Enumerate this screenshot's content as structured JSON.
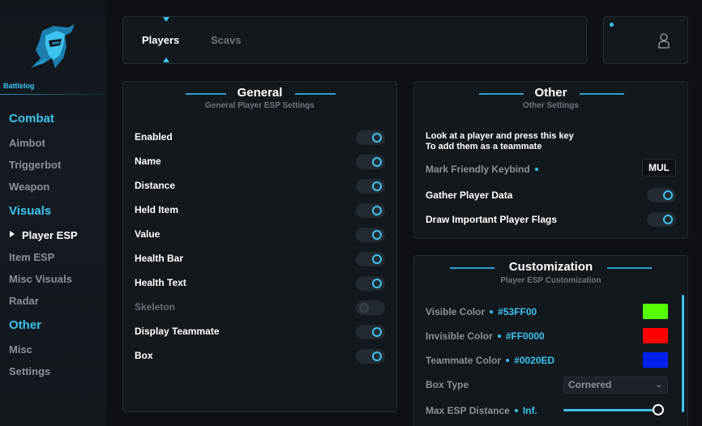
{
  "sidebar": {
    "brand": "Battlelog",
    "sections": [
      {
        "title": "Combat",
        "items": [
          "Aimbot",
          "Triggerbot",
          "Weapon"
        ]
      },
      {
        "title": "Visuals",
        "items": [
          "Player ESP",
          "Item ESP",
          "Misc Visuals",
          "Radar"
        ]
      },
      {
        "title": "Other",
        "items": [
          "Misc",
          "Settings"
        ]
      }
    ],
    "active_item": "Player ESP"
  },
  "tabs": [
    "Players",
    "Scavs"
  ],
  "general": {
    "title": "General",
    "subtitle": "General Player ESP Settings",
    "rows": [
      {
        "label": "Enabled",
        "on": true
      },
      {
        "label": "Name",
        "on": true
      },
      {
        "label": "Distance",
        "on": true
      },
      {
        "label": "Held Item",
        "on": true
      },
      {
        "label": "Value",
        "on": true
      },
      {
        "label": "Health Bar",
        "on": true
      },
      {
        "label": "Health Text",
        "on": true
      },
      {
        "label": "Skeleton",
        "on": false
      },
      {
        "label": "Display Teammate",
        "on": true
      },
      {
        "label": "Box",
        "on": true
      }
    ]
  },
  "other": {
    "title": "Other",
    "subtitle": "Other Settings",
    "note_line1": "Look at a player and press this key",
    "note_line2": "To add them as a teammate",
    "keybind_label": "Mark Friendly Keybind",
    "keybind_value": "MUL",
    "rows": [
      {
        "label": "Gather Player Data",
        "on": true
      },
      {
        "label": "Draw Important Player Flags",
        "on": true
      }
    ]
  },
  "customization": {
    "title": "Customization",
    "subtitle": "Player ESP Customization",
    "colors": [
      {
        "label": "Visible Color",
        "hex": "#53FF00",
        "swatch": "#53ff00"
      },
      {
        "label": "Invisible Color",
        "hex": "#FF0000",
        "swatch": "#ff0000"
      },
      {
        "label": "Teammate Color",
        "hex": "#0020ED",
        "swatch": "#0020ed"
      }
    ],
    "box_type_label": "Box Type",
    "box_type_value": "Cornered",
    "max_distance_label": "Max ESP Distance",
    "max_distance_value": "Inf.",
    "max_distance_fraction": 1.0
  },
  "colors": {
    "accent": "#3cc3f0",
    "panel": "#13181d",
    "background": "#0d1014"
  }
}
